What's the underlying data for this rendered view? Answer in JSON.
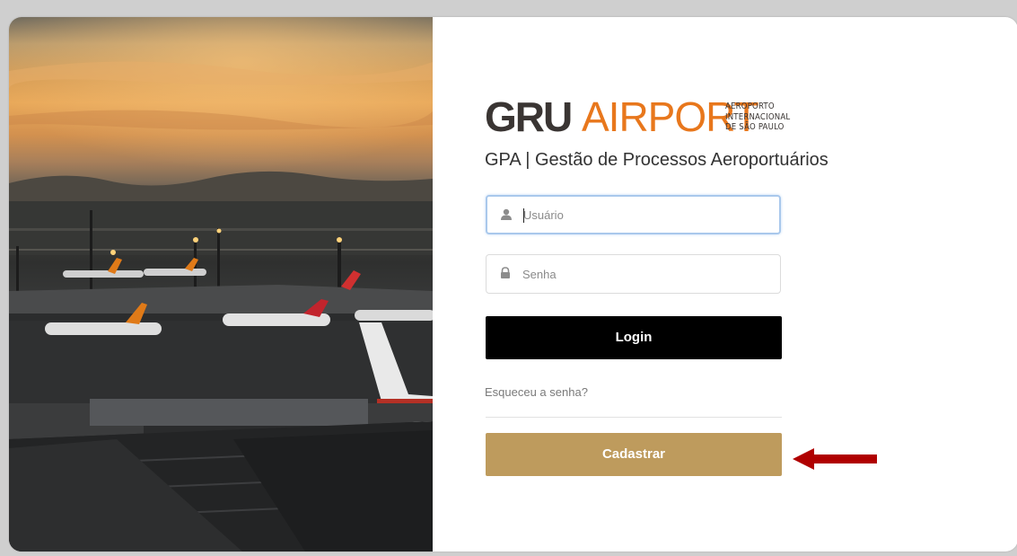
{
  "logo": {
    "brand_bold": "GRU",
    "brand_light": "AIRPORT",
    "subtitle_lines": [
      "AEROPORTO",
      "INTERNACIONAL",
      "DE SÃO PAULO"
    ]
  },
  "app_title": "GPA | Gestão de Processos Aeroportuários",
  "form": {
    "username": {
      "placeholder": "Usuário",
      "value": "",
      "icon": "user-icon",
      "focused": true
    },
    "password": {
      "placeholder": "Senha",
      "value": "",
      "icon": "lock-icon"
    },
    "login_label": "Login",
    "forgot_label": "Esqueceu a senha?",
    "register_label": "Cadastrar"
  },
  "colors": {
    "brand_orange": "#e8771c",
    "brand_dark": "#3a3533",
    "login_button": "#000000",
    "register_button": "#be9b5d",
    "annotation_arrow": "#b00000",
    "focus_border": "#a9c8ec"
  },
  "annotation": {
    "icon": "red-arrow-icon",
    "points_to": "register-button"
  }
}
